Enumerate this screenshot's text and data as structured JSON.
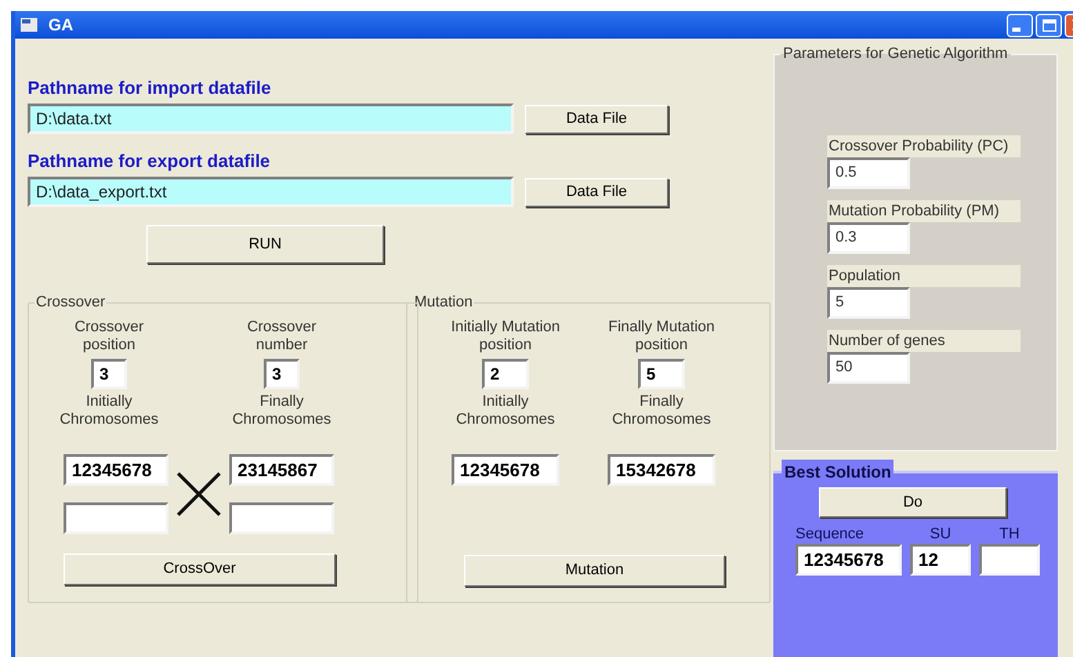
{
  "window": {
    "title": "GA"
  },
  "import": {
    "label": "Pathname for import datafile",
    "value": "D:\\data.txt",
    "button": "Data File"
  },
  "export": {
    "label": "Pathname for export datafile",
    "value": "D:\\data_export.txt",
    "button": "Data File"
  },
  "run_button": "RUN",
  "crossover": {
    "title": "Crossover",
    "position": {
      "label": "Crossover position",
      "value": "3"
    },
    "number": {
      "label": "Crossover number",
      "value": "3"
    },
    "initial": {
      "label": "Initially Chromosomes",
      "value": "12345678"
    },
    "final": {
      "label": "Finally Chromosomes",
      "value": "23145867"
    },
    "button": "CrossOver"
  },
  "mutation": {
    "title": "Mutation",
    "initial_position": {
      "label": "Initially Mutation position",
      "value": "2"
    },
    "final_position": {
      "label": "Finally Mutation position",
      "value": "5"
    },
    "initial": {
      "label": "Initially Chromosomes",
      "value": "12345678"
    },
    "final": {
      "label": "Finally Chromosomes",
      "value": "15342678"
    },
    "button": "Mutation"
  },
  "parameters": {
    "title": "Parameters for Genetic Algorithm",
    "fields": [
      {
        "label": "Crossover Probability (PC)",
        "value": "0.5"
      },
      {
        "label": "Mutation Probability (PM)",
        "value": "0.3"
      },
      {
        "label": "Population",
        "value": "5"
      },
      {
        "label": "Number of genes",
        "value": "50"
      }
    ]
  },
  "best_solution": {
    "title": "Best Solution",
    "button": "Do",
    "fields": [
      {
        "label": "Sequence",
        "value": "12345678"
      },
      {
        "label": "SU",
        "value": "12"
      },
      {
        "label": "TH"
      }
    ]
  }
}
